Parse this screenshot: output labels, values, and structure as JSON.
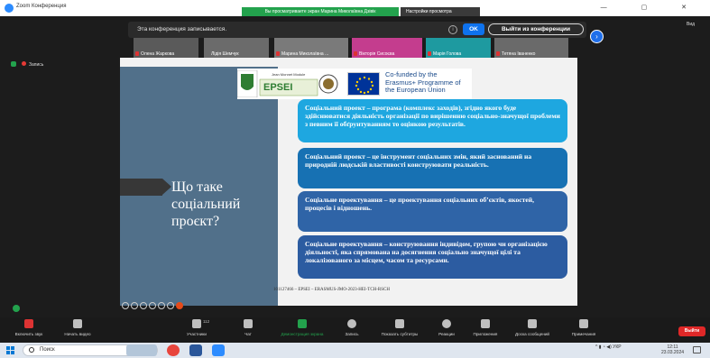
{
  "window": {
    "title": "Zoom Конференция",
    "share_banner": "Вы просматриваете экран Марина Миколаївна Дзівік",
    "view_settings": "Настройки просмотра",
    "controls": "—  ▢  ✕"
  },
  "recording": {
    "message": "Эта конференция записывается.",
    "ok_label": "OK",
    "leave_label": "Выйти из конференции",
    "indicator": "Запись"
  },
  "view_label": "Вид",
  "participants": [
    {
      "name": "Олена Жаркова"
    },
    {
      "name": "Лідія Шемчук"
    },
    {
      "name": "Марина Миколаївна ..."
    },
    {
      "name": "Вікторія Сисоєва"
    },
    {
      "name": "Марія Голова"
    },
    {
      "name": "Тетяна Іваненко"
    }
  ],
  "slide": {
    "question": "Що таке соціальний проєкт?",
    "logo_project": "EPSEI",
    "eu_text": "Co-funded by the Erasmus+ Programme of the European Union",
    "boxes": [
      "Соціальний проект – програма (комплекс заходів), згідно якого буде здійснюватися діяльність організації по вирішенню соціально-значущої проблеми з певним її обґрунтуванням то оцінкою результатів.",
      "Соціальний проект – це інструмент соціальних змін, який заснований на природній людській властивості конструювати реальність.",
      "Соціальне проектування – це проектування соціальних об’єктів, якостей, процесів і відношень.",
      "Соціальне проектування – конструювання індивідом, групою чи організацією діяльності, яка спрямована на досягнення соціально значущої цілі та локалізованого за місцем, часом та ресурсами."
    ],
    "footer": "101127466 – EPSEI – ERASMUS-JMO-2023-HEI-TCH-RSCH"
  },
  "toolbar": {
    "mute": "Включить звук",
    "video": "Начать видео",
    "participants": "Участники",
    "participants_count": "112",
    "chat": "Чат",
    "share": "Демонстрация экрана",
    "record": "Запись",
    "captions": "Показать субтитры",
    "reactions": "Реакции",
    "apps": "Приложения",
    "whiteboard": "Доска сообщений",
    "notes": "Примечания",
    "leave": "Выйти"
  },
  "taskbar": {
    "search": "Поиск",
    "tray": "^  ▮  ◔  ◀)  УКР",
    "time": "12:11",
    "date": "23.03.2024"
  },
  "colors": {
    "zoom_blue": "#0e72ed",
    "share_green": "#23a24d",
    "leave_red": "#e02828",
    "slide_left": "#51708a"
  }
}
